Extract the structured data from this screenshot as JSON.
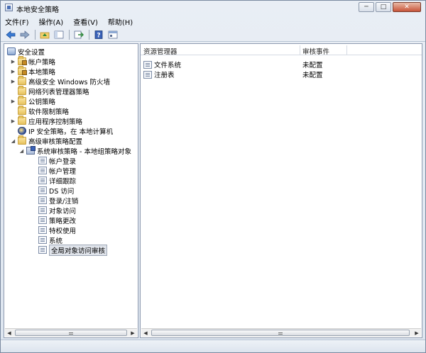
{
  "window": {
    "title": "本地安全策略",
    "min_label": "─",
    "max_label": "□",
    "close_label": "✕"
  },
  "menu": [
    "文件(F)",
    "操作(A)",
    "查看(V)",
    "帮助(H)"
  ],
  "tree": {
    "root": "安全设置",
    "items": [
      {
        "label": "帐户策略",
        "icon": "lock-folder-icon",
        "expand": "▶"
      },
      {
        "label": "本地策略",
        "icon": "lock-folder-icon",
        "expand": "▶"
      },
      {
        "label": "高级安全 Windows 防火墙",
        "icon": "firewall-icon",
        "expand": "▶"
      },
      {
        "label": "网络列表管理器策略",
        "icon": "folder-icon",
        "expand": ""
      },
      {
        "label": "公钥策略",
        "icon": "folder-icon",
        "expand": "▶"
      },
      {
        "label": "软件限制策略",
        "icon": "folder-icon",
        "expand": ""
      },
      {
        "label": "应用程序控制策略",
        "icon": "folder-icon",
        "expand": "▶"
      },
      {
        "label": "IP 安全策略，在 本地计算机",
        "icon": "ipsec-icon",
        "expand": ""
      },
      {
        "label": "高级审核策略配置",
        "icon": "folder-icon",
        "expand": "◢"
      },
      {
        "label": "系统审核策略 - 本地组策略对象",
        "icon": "policy-icon",
        "expand": "◢"
      }
    ],
    "sub_items": [
      "帐户登录",
      "帐户管理",
      "详细跟踪",
      "DS 访问",
      "登录/注销",
      "对象访问",
      "策略更改",
      "特权使用",
      "系统",
      "全局对象访问审核"
    ],
    "selected": "全局对象访问审核"
  },
  "list": {
    "columns": [
      "资源管理器",
      "审核事件"
    ],
    "rows": [
      {
        "name": "文件系统",
        "status": "未配置"
      },
      {
        "name": "注册表",
        "status": "未配置"
      }
    ]
  },
  "colors": {
    "window_bg": "#e9eef5",
    "selection_bg": "#dfe3ea",
    "close_button": "#c8553a"
  }
}
